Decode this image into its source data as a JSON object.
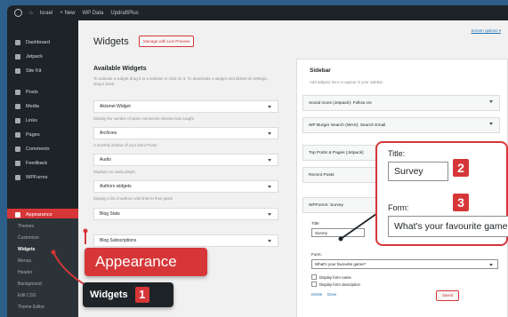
{
  "admin_bar": {
    "items": [
      "Israel",
      "+ New",
      "WP Data",
      "UpdraftPlus"
    ]
  },
  "sidebar": {
    "items": [
      {
        "label": "Dashboard"
      },
      {
        "label": "Jetpack"
      },
      {
        "label": "Site Kit"
      },
      {
        "label": "Posts"
      },
      {
        "label": "Media"
      },
      {
        "label": "Links"
      },
      {
        "label": "Pages"
      },
      {
        "label": "Comments"
      },
      {
        "label": "Feedback"
      },
      {
        "label": "WPForms"
      },
      {
        "label": "Appearance"
      }
    ],
    "submenu": [
      "Themes",
      "Customize",
      "Widgets",
      "Menus",
      "Header",
      "Background",
      "Edit CSS",
      "Theme Editor"
    ]
  },
  "page": {
    "title": "Widgets",
    "manage_button": "Manage with Live Preview",
    "screen_options": "Screen options ▾"
  },
  "available": {
    "title": "Available Widgets",
    "description": "To activate a widget drag it to a sidebar or click on it. To deactivate a widget and delete its settings, drag it back.",
    "widgets": [
      {
        "name": "Akismet Widget",
        "desc": "Display the number of spam comments Akismet has caught"
      },
      {
        "name": "Archives",
        "desc": "A monthly archive of your site's Posts."
      },
      {
        "name": "Audio",
        "desc": "Displays an audio player."
      },
      {
        "name": "Authors widgets",
        "desc": "Display a list of authors with links to their posts"
      },
      {
        "name": "Blog Stats",
        "desc": ""
      },
      {
        "name": "Blog Subscriptions",
        "desc": ""
      }
    ]
  },
  "sidebar_area": {
    "title": "Sidebar",
    "description": "Add widgets here to appear in your sidebar.",
    "widgets": [
      "Social Icons (Jetpack): Follow Us",
      "WP Burger Search (WAS): Search Email",
      "Top Posts & Pages (Jetpack)",
      "Recent Posts",
      "WPForms: Survey"
    ],
    "form": {
      "title_label": "Title:",
      "title_value": "Survey",
      "form_label": "Form:",
      "form_value": "What's your favourite game?",
      "check1": "Display form name",
      "check2": "Display form description",
      "delete": "Delete",
      "done": "Done",
      "saved": "Saved"
    }
  },
  "zoom": {
    "title_label": "Title:",
    "title_value": "Survey",
    "form_label": "Form:",
    "form_value": "What's your favourite game?",
    "badge_2": "2",
    "badge_3": "3"
  },
  "callouts": {
    "appearance": "Appearance",
    "widgets": "Widgets",
    "badge_1": "1"
  },
  "colors": {
    "accent": "#d63638",
    "admin_dark": "#1d2327",
    "background": "#2e5f8a"
  }
}
